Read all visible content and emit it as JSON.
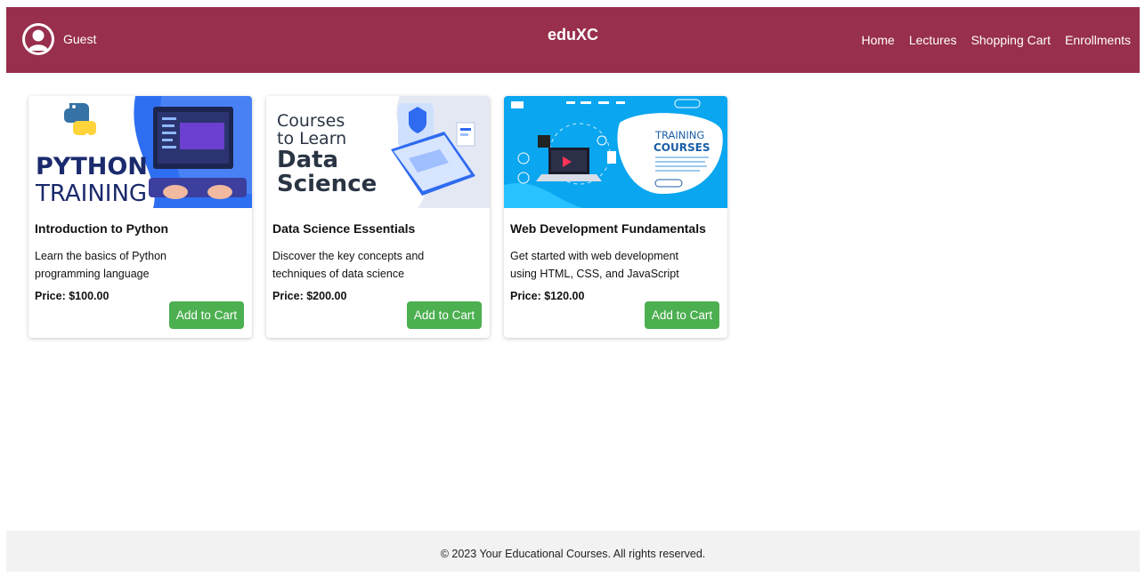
{
  "header": {
    "user_name": "Guest",
    "brand": "eduXC",
    "nav": [
      "Home",
      "Lectures",
      "Shopping Cart",
      "Enrollments"
    ]
  },
  "courses": [
    {
      "title": "Introduction to Python",
      "description": "Learn the basics of Python programming language",
      "price": "Price: $100.00",
      "button": "Add to Cart",
      "thumb_text": [
        "PYTHON",
        "TRAINING"
      ]
    },
    {
      "title": "Data Science Essentials",
      "description": "Discover the key concepts and techniques of data science",
      "price": "Price: $200.00",
      "button": "Add to Cart",
      "thumb_text": [
        "Courses",
        "to Learn",
        "Data",
        "Science"
      ]
    },
    {
      "title": "Web Development Fundamentals",
      "description": "Get started with web development using HTML, CSS, and JavaScript",
      "price": "Price: $120.00",
      "button": "Add to Cart",
      "thumb_text": [
        "TRAINING",
        "COURSES"
      ]
    }
  ],
  "footer": {
    "text": "© 2023 Your Educational Courses. All rights reserved."
  },
  "colors": {
    "header_bg": "#982f4c",
    "button_bg": "#4caf50",
    "footer_bg": "#f2f2f2"
  }
}
